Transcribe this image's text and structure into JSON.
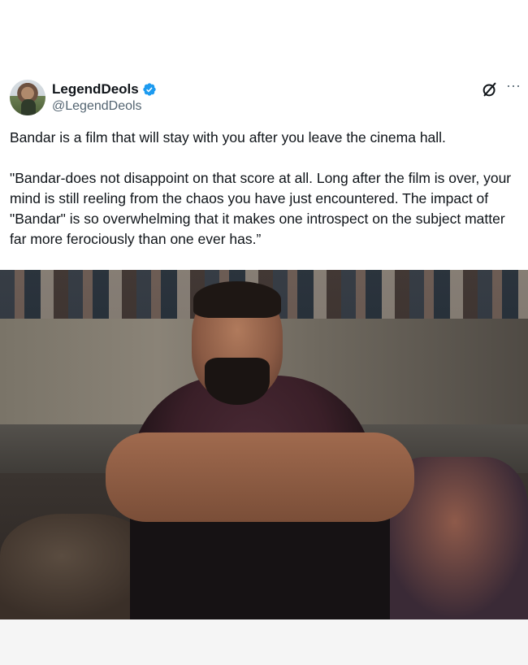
{
  "author": {
    "display_name": "LegendDeols",
    "handle": "@LegendDeols",
    "verified": true
  },
  "icons": {
    "grok": "grok-icon",
    "more": "more-options-icon",
    "verified": "verified-badge-icon"
  },
  "tweet": {
    "paragraphs": [
      "Bandar is a film that will stay with you after you leave the cinema hall.",
      "\"Bandar-does not disappoint on that score at all. Long after the film is over, your mind is still reeling from the chaos you have just encountered. The impact of \"Bandar\" is so overwhelming that it makes one introspect on the subject matter far more ferociously than one ever has.”"
    ]
  },
  "media": {
    "description_icon": "photo"
  },
  "colors": {
    "text_primary": "#0f1419",
    "text_secondary": "#536471",
    "verified_blue": "#1d9bf0"
  }
}
